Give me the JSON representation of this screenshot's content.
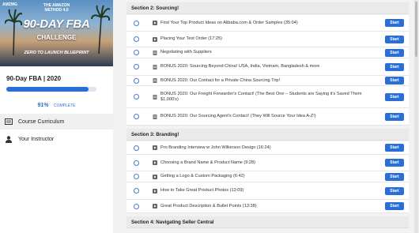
{
  "sidebar": {
    "hero": {
      "brand": "AMZMG",
      "method_line1": "THE AMAZON",
      "method_line2": "METHOD 4.0",
      "title": "90-DAY FBA",
      "challenge": "CHALLENGE",
      "subtitle": "ZERO TO LAUNCH BLUEPRINT"
    },
    "course_title": "90-Day FBA | 2020",
    "progress": {
      "percent": 91,
      "percent_label": "91%",
      "complete_label": "COMPLETE"
    },
    "nav": [
      {
        "label": "Course Curriculum",
        "icon": "curriculum-icon"
      },
      {
        "label": "Your Instructor",
        "icon": "user-icon"
      }
    ]
  },
  "sections": [
    {
      "title": "Section 2: Sourcing!",
      "items": [
        {
          "label": "Find Your Top Product Ideas on Alibaba.com & Order Samples (35:04)",
          "type": "video",
          "start": "Start"
        },
        {
          "label": "Placing Your Test Order (17:25)",
          "type": "video",
          "start": "Start"
        },
        {
          "label": "Negotiating with Suppliers",
          "type": "document",
          "start": "Start"
        },
        {
          "label": "BONUS 2020: Sourcing Beyond China! USA, India, Vietnam, Bangladesh & more",
          "type": "document",
          "start": "Start"
        },
        {
          "label": "BONUS 2020: Our Contact for a Private China Sourcing Trip!",
          "type": "document",
          "start": "Start"
        },
        {
          "label_line1": "BONUS 2020: Our Freight Forwarder's Contact! (The Best One – Students are Saying it's Saved Them",
          "label_line2": "$1,000's)",
          "type": "document",
          "start": "Start"
        },
        {
          "label": "BONUS 2020: Our Sourcing Agent's Contact! (They Will Source Your Idea A-Z!)",
          "type": "document",
          "start": "Start"
        }
      ]
    },
    {
      "title": "Section 3: Branding!",
      "items": [
        {
          "label": "Pro Branding Interview w John Wilkinson Design (16:24)",
          "type": "video",
          "start": "Start"
        },
        {
          "label": "Choosing a Brand Name & Product Name (9:28)",
          "type": "video",
          "start": "Start"
        },
        {
          "label": "Getting a Logo & Custom Packaging (6:42)",
          "type": "video",
          "start": "Start"
        },
        {
          "label": "How to Take Great Product Photos (13:09)",
          "type": "video",
          "start": "Start"
        },
        {
          "label": "Great Product Description & Bullet Points (13:38)",
          "type": "video",
          "start": "Start"
        }
      ]
    },
    {
      "title": "Section 4: Navigating Seller Central",
      "items": []
    }
  ],
  "colors": {
    "accent": "#2a6fd6",
    "section_bg": "#eaeaea",
    "page_bg": "#f2f2f2"
  }
}
